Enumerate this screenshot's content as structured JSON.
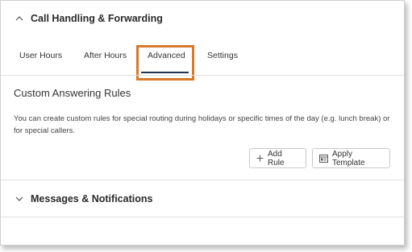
{
  "sections": {
    "call_handling": {
      "title": "Call Handling & Forwarding",
      "icon": "chevron-up-icon"
    },
    "messages": {
      "title": "Messages & Notifications",
      "icon": "chevron-down-icon"
    }
  },
  "tabs": [
    {
      "label": "User Hours",
      "active": false
    },
    {
      "label": "After Hours",
      "active": false
    },
    {
      "label": "Advanced",
      "active": true
    },
    {
      "label": "Settings",
      "active": false
    }
  ],
  "custom_rules": {
    "title": "Custom Answering Rules",
    "description": "You can create custom rules for special routing during holidays or specific times of the day (e.g. lunch break) or for special callers."
  },
  "buttons": {
    "add_rule": {
      "label": "Add Rule",
      "icon": "plus-icon"
    },
    "apply_template": {
      "label": "Apply Template",
      "icon": "template-icon"
    }
  },
  "colors": {
    "highlight": "#d8782a",
    "active_tab_underline": "#1f3550"
  }
}
